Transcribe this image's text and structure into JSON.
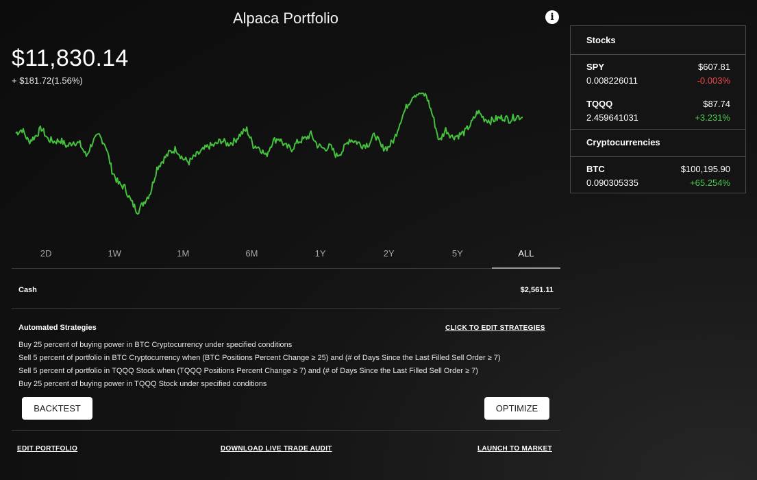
{
  "header": {
    "title": "Alpaca Portfolio",
    "info_icon": "info-icon"
  },
  "portfolio": {
    "total_value": "$11,830.14",
    "change": "+ $181.72(1.56%)"
  },
  "chart_data": {
    "type": "line",
    "line_color": "#44c13d",
    "grid": false,
    "y_range": [
      0,
      100
    ],
    "series": [
      {
        "values": [
          67,
          70,
          60,
          64,
          71,
          62,
          60,
          61,
          56,
          60,
          58,
          48,
          60,
          65,
          57,
          36,
          25,
          22,
          10,
          2,
          10,
          18,
          38,
          45,
          51,
          54,
          46,
          43,
          48,
          52,
          56,
          57,
          61,
          58,
          60,
          66,
          70,
          57,
          55,
          48,
          60,
          63,
          56,
          54,
          60,
          62,
          66,
          57,
          54,
          56,
          48,
          53,
          62,
          60,
          57,
          58,
          66,
          55,
          55,
          62,
          78,
          90,
          99,
          100,
          98,
          81,
          60,
          70,
          64,
          65,
          68,
          75,
          85,
          79,
          77,
          79,
          80,
          78,
          81,
          80
        ]
      }
    ],
    "notes": "Portfolio value history (relative scale, no axis labels shown)"
  },
  "range_tabs": [
    {
      "label": "2D",
      "active": false
    },
    {
      "label": "1W",
      "active": false
    },
    {
      "label": "1M",
      "active": false
    },
    {
      "label": "6M",
      "active": false
    },
    {
      "label": "1Y",
      "active": false
    },
    {
      "label": "2Y",
      "active": false
    },
    {
      "label": "5Y",
      "active": false
    },
    {
      "label": "ALL",
      "active": true
    }
  ],
  "cash": {
    "label": "Cash",
    "value": "$2,561.11"
  },
  "strategies": {
    "title": "Automated Strategies",
    "edit_link": "CLICK TO EDIT STRATEGIES",
    "items": [
      "Buy 25 percent of buying power in BTC Cryptocurrency under specified conditions",
      "Sell 5 percent of portfolio in BTC Cryptocurrency when (BTC Positions Percent Change ≥ 25) and (# of Days Since the Last Filled Sell Order ≥ 7)",
      "Sell 5 percent of portfolio in TQQQ Stock when (TQQQ Positions Percent Change ≥ 7) and (# of Days Since the Last Filled Sell Order ≥ 7)",
      "Buy 25 percent of buying power in TQQQ Stock under specified conditions"
    ]
  },
  "buttons": {
    "backtest": "BACKTEST",
    "optimize": "OPTIMIZE"
  },
  "footer": {
    "edit_portfolio": "EDIT PORTFOLIO",
    "download_audit": "DOWNLOAD LIVE TRADE AUDIT",
    "launch": "LAUNCH TO MARKET"
  },
  "holdings": {
    "stocks_title": "Stocks",
    "stocks": [
      {
        "symbol": "SPY",
        "price": "$607.81",
        "quantity": "0.008226011",
        "change": "-0.003%",
        "direction": "negative"
      },
      {
        "symbol": "TQQQ",
        "price": "$87.74",
        "quantity": "2.459641031",
        "change": "+3.231%",
        "direction": "positive"
      }
    ],
    "crypto_title": "Cryptocurrencies",
    "crypto": [
      {
        "symbol": "BTC",
        "price": "$100,195.90",
        "quantity": "0.090305335",
        "change": "+65.254%",
        "direction": "positive"
      }
    ]
  },
  "colors": {
    "positive": "#4ec94e",
    "negative": "#ee4b4b",
    "chart_line": "#44c13d"
  }
}
